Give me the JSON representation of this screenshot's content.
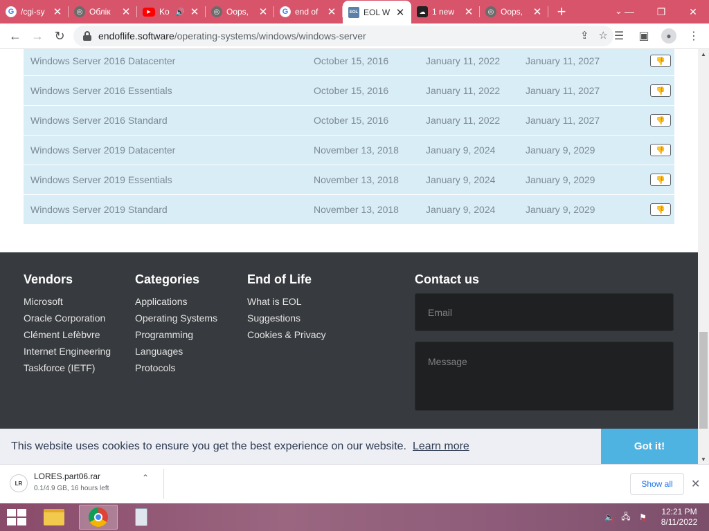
{
  "browser": {
    "tabs": [
      {
        "title": "/cgi-sy",
        "favicon": "google-icon",
        "active": false
      },
      {
        "title": "Облік",
        "favicon": "globe-icon",
        "active": false
      },
      {
        "title": "Ko",
        "favicon": "youtube-icon",
        "active": false,
        "audio": true
      },
      {
        "title": "Oops,",
        "favicon": "globe-icon",
        "active": false
      },
      {
        "title": "end of",
        "favicon": "google-icon",
        "active": false
      },
      {
        "title": "EOL W",
        "favicon": "eol-icon",
        "active": true
      },
      {
        "title": "1 new",
        "favicon": "cloud-upload-icon",
        "active": false
      },
      {
        "title": "Oops,",
        "favicon": "globe-icon",
        "active": false
      }
    ],
    "new_tab_symbol": "+",
    "address": {
      "host": "endoflife.software",
      "path": "/operating-systems/windows/windows-server"
    },
    "accent": "#d7546b"
  },
  "table": {
    "rows": [
      {
        "name": "Windows Server 2016 Datacenter",
        "release": "October 15, 2016",
        "end_support": "January 11, 2022",
        "end_life": "January 11, 2027"
      },
      {
        "name": "Windows Server 2016 Essentials",
        "release": "October 15, 2016",
        "end_support": "January 11, 2022",
        "end_life": "January 11, 2027"
      },
      {
        "name": "Windows Server 2016 Standard",
        "release": "October 15, 2016",
        "end_support": "January 11, 2022",
        "end_life": "January 11, 2027"
      },
      {
        "name": "Windows Server 2019 Datacenter",
        "release": "November 13, 2018",
        "end_support": "January 9, 2024",
        "end_life": "January 9, 2029"
      },
      {
        "name": "Windows Server 2019 Essentials",
        "release": "November 13, 2018",
        "end_support": "January 9, 2024",
        "end_life": "January 9, 2029"
      },
      {
        "name": "Windows Server 2019 Standard",
        "release": "November 13, 2018",
        "end_support": "January 9, 2024",
        "end_life": "January 9, 2029"
      }
    ],
    "row_color": "#d9edf7"
  },
  "footer": {
    "vendors": {
      "heading": "Vendors",
      "links": [
        "Microsoft",
        "Oracle Corporation",
        "Clément Lefèbvre",
        "Internet Engineering",
        "Taskforce (IETF)"
      ]
    },
    "categories": {
      "heading": "Categories",
      "links": [
        "Applications",
        "Operating Systems",
        "Programming",
        "Languages",
        "Protocols"
      ]
    },
    "end_of_life": {
      "heading": "End of Life",
      "links": [
        "What is EOL",
        "Suggestions",
        "Cookies & Privacy"
      ]
    },
    "contact": {
      "heading": "Contact us",
      "email_placeholder": "Email",
      "message_placeholder": "Message"
    }
  },
  "cookie_banner": {
    "text": "This website uses cookies to ensure you get the best experience on our website.",
    "learn_more": "Learn more",
    "accept": "Got it!",
    "accent": "#4fb3e2"
  },
  "downloads": {
    "file_name": "LORES.part06.rar",
    "status": "0.1/4.9 GB, 16 hours left",
    "show_all": "Show all"
  },
  "taskbar": {
    "time": "12:21 PM",
    "date": "8/11/2022"
  }
}
